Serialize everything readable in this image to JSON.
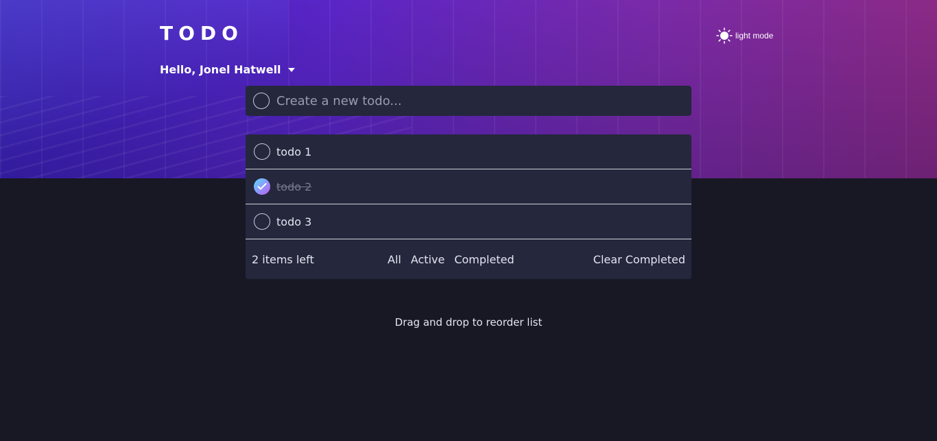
{
  "app": {
    "logo": "TODO"
  },
  "theme_toggle": {
    "label": "light mode",
    "icon": "sun-icon"
  },
  "user": {
    "greeting": "Hello, Jonel Hatwell",
    "menu_icon": "caret-down-icon"
  },
  "new_todo": {
    "placeholder": "Create a new todo...",
    "value": ""
  },
  "todos": [
    {
      "label": "todo 1",
      "completed": false
    },
    {
      "label": "todo 2",
      "completed": true
    },
    {
      "label": "todo 3",
      "completed": false
    }
  ],
  "footer": {
    "items_left": "2 items left",
    "filters": [
      "All",
      "Active",
      "Completed"
    ],
    "clear": "Clear Completed"
  },
  "hint": "Drag and drop to reorder list",
  "colors": {
    "background": "#181824",
    "card": "#25273c",
    "check_gradient_start": "#57ddff",
    "check_gradient_end": "#c058f3",
    "hero_left": "#3a1fb5",
    "hero_right": "#8b2a86"
  }
}
